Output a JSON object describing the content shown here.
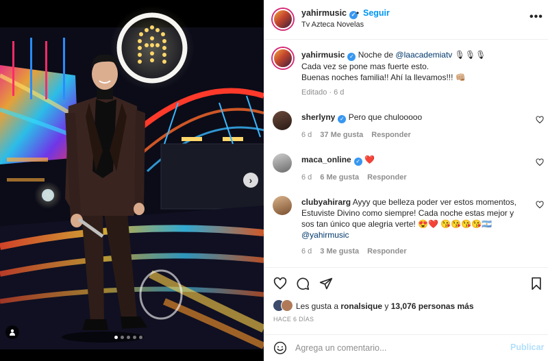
{
  "header": {
    "username": "yahirmusic",
    "follow_label": "Seguir",
    "separator": "•",
    "subtitle": "Tv Azteca Novelas",
    "more_label": "•••"
  },
  "caption": {
    "username": "yahirmusic",
    "text_before_mention": "Noche de ",
    "mention": "@laacademiatv",
    "emojis": "🎙🎙🎙",
    "line2": "Cada vez se pone mas fuerte esto.",
    "line3": "Buenas noches familia!! Ahí la llevamos!!! 👊🏼",
    "meta": "Editado · 6 d"
  },
  "comments": [
    {
      "username": "sherlyny",
      "text": "Pero que chulooooo",
      "time": "6 d",
      "likes": "37 Me gusta",
      "reply_label": "Responder"
    },
    {
      "username": "maca_online",
      "text": "❤️",
      "time": "6 d",
      "likes": "6 Me gusta",
      "reply_label": "Responder"
    },
    {
      "username": "clubyahirarg",
      "text": "Ayyy que belleza poder ver estos momentos, Estuviste Divino como siempre! Cada noche estas mejor y sos tan único que alegria verte! 😍❤️ 😘😘😘😘🇦🇷",
      "mention": "@yahirmusic",
      "time": "6 d",
      "likes": "3 Me gusta",
      "reply_label": "Responder"
    }
  ],
  "likes": {
    "prefix": "Les gusta a ",
    "user": "ronalsique",
    "middle": " y ",
    "others": "13,076 personas más"
  },
  "time_ago": "HACE 6 DÍAS",
  "add_comment": {
    "placeholder": "Agrega un comentario...",
    "post_label": "Publicar"
  },
  "media": {
    "arrow": "›",
    "carousel_dots": 5,
    "active_dot": 1
  },
  "colors": {
    "accent": "#0095f6",
    "verified": "#3897f0",
    "heart_red": "#ed4956"
  }
}
